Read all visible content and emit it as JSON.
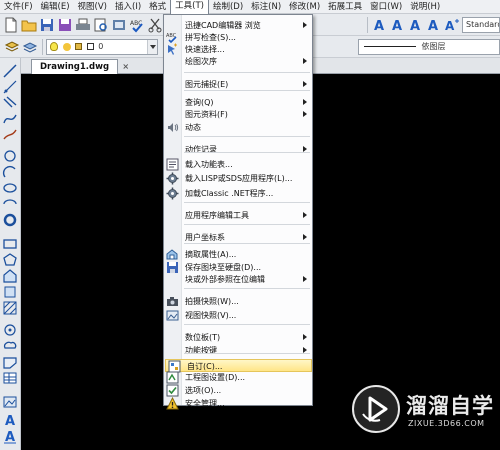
{
  "menubar": {
    "items": [
      "文件(F)",
      "编辑(E)",
      "视图(V)",
      "插入(I)",
      "格式",
      "工具(T)",
      "绘制(D)",
      "标注(N)",
      "修改(M)",
      "拓展工具",
      "窗口(W)",
      "说明(H)"
    ],
    "active_index": 5
  },
  "toolbar": {
    "text_style": "Standard",
    "layer_value": "0",
    "linetype_label": "依图层"
  },
  "document_tab": {
    "title": "Drawing1.dwg",
    "close_symbol": "×"
  },
  "tools_menu": {
    "items": [
      {
        "label": "迅捷CAD编辑器 浏览",
        "icon": "none",
        "submenu": true
      },
      {
        "label": "拼写检查(S)...",
        "icon": "spellcheck-icon",
        "submenu": false
      },
      {
        "label": "快速选择...",
        "icon": "quick-select-icon",
        "submenu": false
      },
      {
        "label": "绘图次序",
        "icon": "none",
        "submenu": true
      },
      {
        "label": "图元捕捉(E)",
        "icon": "none",
        "submenu": true
      },
      {
        "label": "查询(Q)",
        "icon": "none",
        "submenu": true
      },
      {
        "label": "图元资料(F)",
        "icon": "none",
        "submenu": true
      },
      {
        "label": "动态",
        "icon": "speaker-icon",
        "submenu": false
      },
      {
        "label": "动作记录",
        "icon": "none",
        "submenu": true
      },
      {
        "label": "载入功能表...",
        "icon": "load-menu-icon",
        "submenu": false
      },
      {
        "label": "载入LISP或SDS应用程序(L)...",
        "icon": "gear-icon",
        "submenu": false
      },
      {
        "label": "加载Classic .NET程序...",
        "icon": "gear-icon",
        "submenu": false
      },
      {
        "label": "应用程序编辑工具",
        "icon": "none",
        "submenu": true
      },
      {
        "label": "用户坐标系",
        "icon": "none",
        "submenu": true
      },
      {
        "label": "摘取属性(A)...",
        "icon": "extract-attributes-icon",
        "submenu": false
      },
      {
        "label": "保存图块至硬盘(D)...",
        "icon": "save-block-icon",
        "submenu": false
      },
      {
        "label": "块或外部参照在位编辑",
        "icon": "none",
        "submenu": true
      },
      {
        "label": "拍摄快照(W)...",
        "icon": "camera-icon",
        "submenu": false
      },
      {
        "label": "视图快照(V)...",
        "icon": "view-snapshot-icon",
        "submenu": false
      },
      {
        "label": "数位板(T)",
        "icon": "none",
        "submenu": true
      },
      {
        "label": "功能按键",
        "icon": "none",
        "submenu": true
      },
      {
        "label": "自订(C)...",
        "icon": "customize-icon",
        "submenu": false
      },
      {
        "label": "工程图设置(D)...",
        "icon": "drawing-settings-icon",
        "submenu": false
      },
      {
        "label": "选项(O)...",
        "icon": "options-icon",
        "submenu": false
      },
      {
        "label": "安全管理...",
        "icon": "warning-icon",
        "submenu": false
      }
    ],
    "highlighted_index": 21
  },
  "watermark": {
    "title": "溜溜自学",
    "subtitle": "ZIXUE.3D66.COM"
  },
  "colors": {
    "canvas": "#000000",
    "menu_highlight": "#ffe587",
    "chrome": "#e7eaee"
  }
}
